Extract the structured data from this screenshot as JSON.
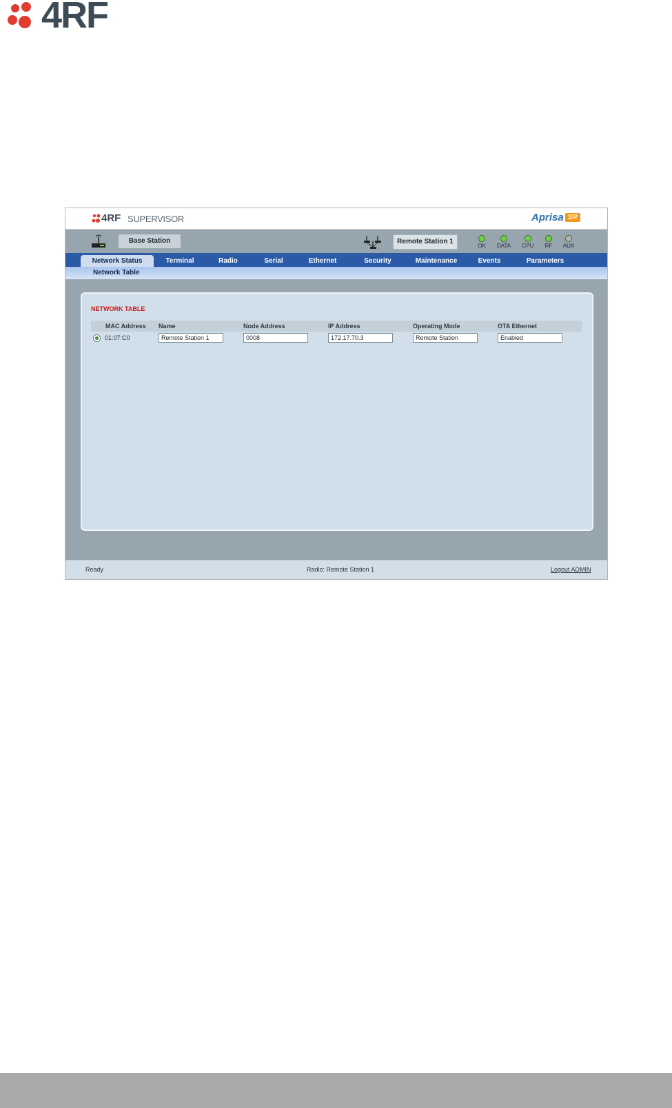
{
  "page": {
    "logo_text": "4RF"
  },
  "app": {
    "brand": "4RF",
    "product": "SUPERVISOR",
    "model": "Aprisa",
    "model_badge": "SR"
  },
  "status": {
    "local_station": "Base Station",
    "remote_station": "Remote Station 1",
    "leds": [
      {
        "label": "OK",
        "color": "#6fd04a"
      },
      {
        "label": "DATA",
        "color": "#6fd04a"
      },
      {
        "label": "CPU",
        "color": "#6fd04a"
      },
      {
        "label": "RF",
        "color": "#6fd04a"
      },
      {
        "label": "AUX",
        "color": "#b7b7b7"
      }
    ]
  },
  "nav": {
    "tabs": [
      "Network Status",
      "Terminal",
      "Radio",
      "Serial",
      "Ethernet",
      "Security",
      "Maintenance",
      "Events",
      "Parameters"
    ],
    "active": "Network Status",
    "subtab": "Network Table"
  },
  "network_table": {
    "title": "NETWORK TABLE",
    "columns": [
      "MAC Address",
      "Name",
      "Node Address",
      "IP Address",
      "Operating Mode",
      "OTA Ethernet"
    ],
    "rows": [
      {
        "selected": true,
        "mac": "01:07:C0",
        "name": "Remote Station 1",
        "node_address": "0008",
        "ip": "172.17.70.3",
        "mode": "Remote Station",
        "ota_ethernet": "Enabled"
      }
    ]
  },
  "footer": {
    "status": "Ready",
    "radio": "Radio: Remote Station 1",
    "logout": "Logout ADMIN"
  },
  "colors": {
    "nav_blue": "#2b5aa6",
    "panel": "#d0dfe9",
    "title_red": "#cc1a1a",
    "brand_orange": "#f29a1f"
  }
}
